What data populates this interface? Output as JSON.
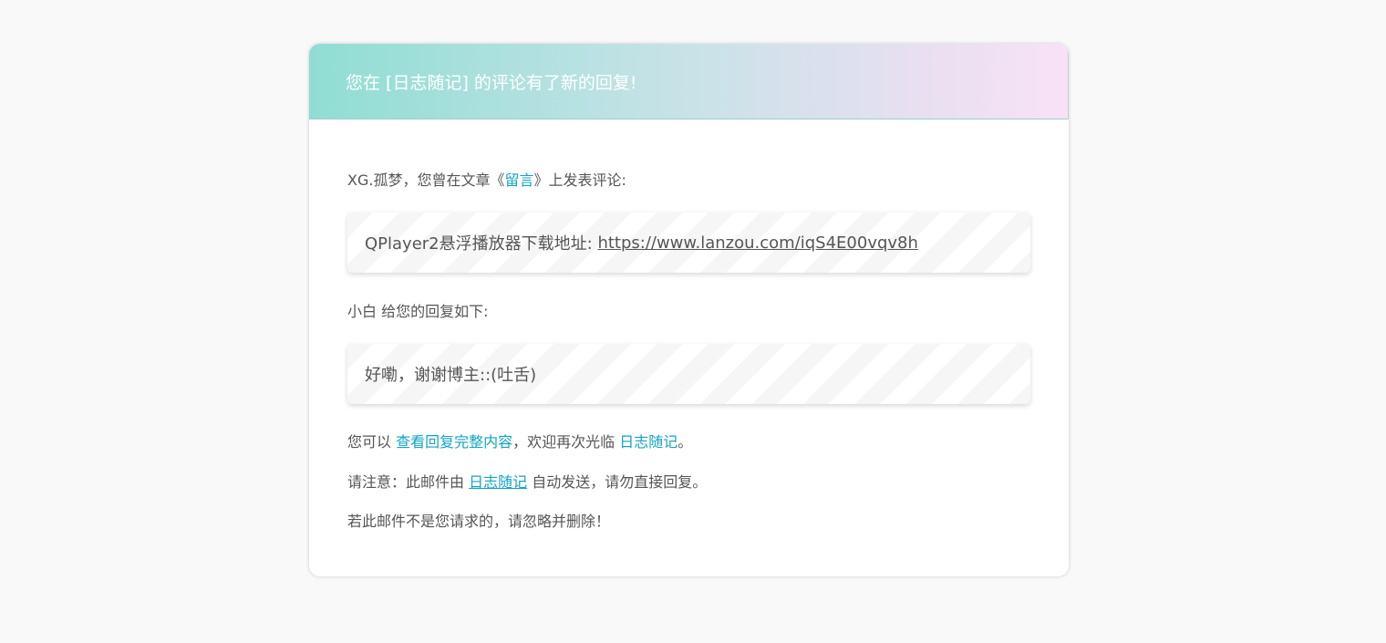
{
  "header": {
    "title": "您在 [日志随记] 的评论有了新的回复!"
  },
  "intro": {
    "prefix": "XG.孤梦，您曾在文章《",
    "article_link": "留言",
    "suffix": "》上发表评论:"
  },
  "original_comment": {
    "text": "QPlayer2悬浮播放器下载地址: ",
    "url_text": "https://www.lanzou.com/iqS4E00vqv8h"
  },
  "reply_intro": {
    "text": "小白 给您的回复如下:"
  },
  "reply": {
    "text": "好嘞，谢谢博主::(吐舌)"
  },
  "footer": {
    "view_prefix": "您可以 ",
    "view_link": "查看回复完整内容",
    "welcome_text": "，欢迎再次光临 ",
    "site_link": "日志随记",
    "end": "。",
    "notice_prefix": "请注意：此邮件由 ",
    "notice_link": "日志随记",
    "notice_suffix": " 自动发送，请勿直接回复。",
    "ignore_text": "若此邮件不是您请求的，请忽略并删除！"
  }
}
